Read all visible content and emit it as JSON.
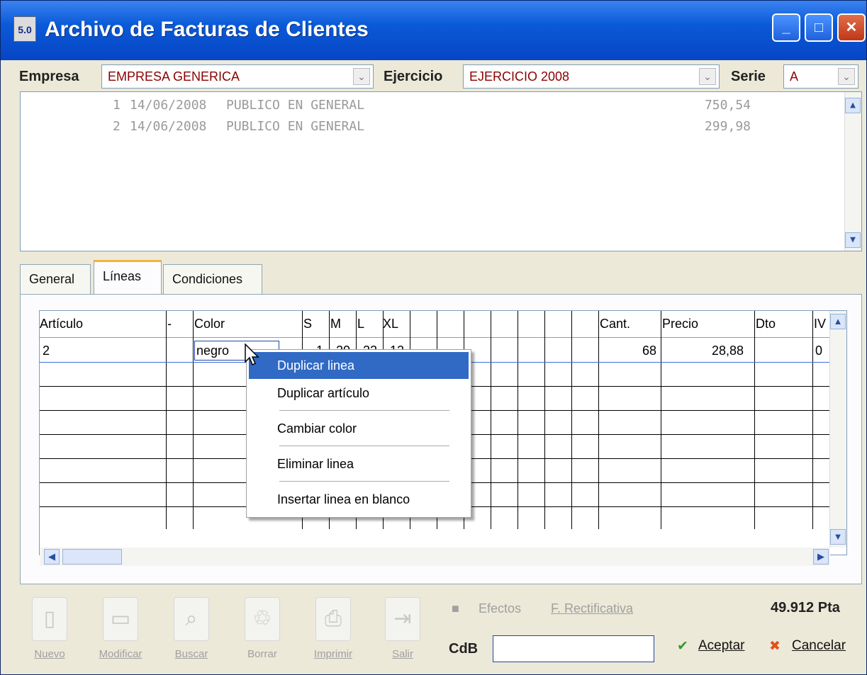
{
  "window": {
    "title": "Archivo de Facturas de Clientes",
    "icon_text": "5.0"
  },
  "titlebar": {
    "minimize": "_",
    "maximize": "□",
    "close": "✕"
  },
  "filters": {
    "empresa_label": "Empresa",
    "empresa_value": "EMPRESA GENERICA",
    "ejercicio_label": "Ejercicio",
    "ejercicio_value": "EJERCICIO 2008",
    "serie_label": "Serie",
    "serie_value": "A"
  },
  "invoice_list": [
    {
      "num": "1",
      "date": "14/06/2008",
      "client": "PUBLICO EN GENERAL",
      "amount": "750,54"
    },
    {
      "num": "2",
      "date": "14/06/2008",
      "client": "PUBLICO EN GENERAL",
      "amount": "299,98"
    }
  ],
  "tabs": [
    "General",
    "Líneas",
    "Condiciones"
  ],
  "grid": {
    "headers": [
      "Artículo",
      "-",
      "Color",
      "S",
      "M",
      "L",
      "XL",
      "Cant.",
      "Precio",
      "Dto",
      "IV"
    ],
    "row": {
      "articulo": "2",
      "color": "negro",
      "s": "1",
      "m": "20",
      "l": "22",
      "xl": "12",
      "cant": "68",
      "precio": "28,88",
      "dto": "",
      "iva": "0"
    }
  },
  "context_menu": [
    "Duplicar linea",
    "Duplicar artículo",
    "Cambiar color",
    "Eliminar linea",
    "Insertar linea en blanco"
  ],
  "toolbar": [
    "Nuevo",
    "Modificar",
    "Buscar",
    "Borrar",
    "Imprimir",
    "Salir"
  ],
  "bottom": {
    "efectos": "Efectos",
    "rectificativa": "F. Rectificativa",
    "total": "49.912 Pta",
    "cdb_label": "CdB",
    "accept": "Aceptar",
    "cancel": "Cancelar"
  }
}
